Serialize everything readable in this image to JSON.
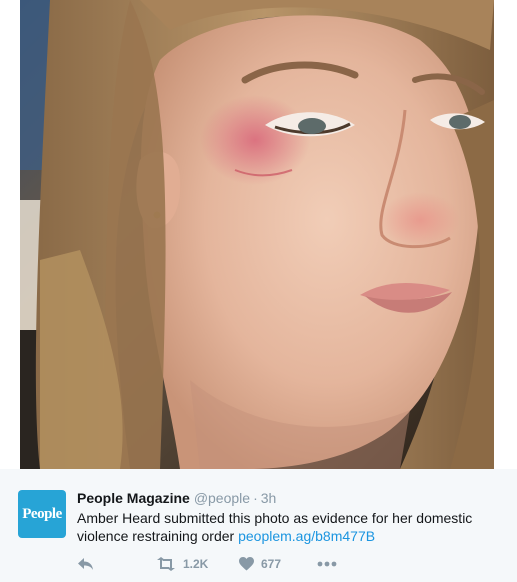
{
  "tweet": {
    "author_name": "People Magazine",
    "handle": "@people",
    "separator": "·",
    "time": "3h",
    "avatar_text": "People",
    "text": "Amber Heard submitted this photo as evidence for her domestic violence restraining order ",
    "link": "peoplem.ag/b8m477B",
    "retweet_count": "1.2K",
    "like_count": "677"
  },
  "icons": {
    "reply": "reply-icon",
    "retweet": "retweet-icon",
    "like": "heart-icon",
    "more": "more-dots-icon"
  },
  "colors": {
    "brand_blue": "#27a4d6",
    "link_blue": "#1b95e0",
    "muted_gray": "#8899a6",
    "text_dark": "#14171a",
    "background": "#f5f8fa"
  }
}
